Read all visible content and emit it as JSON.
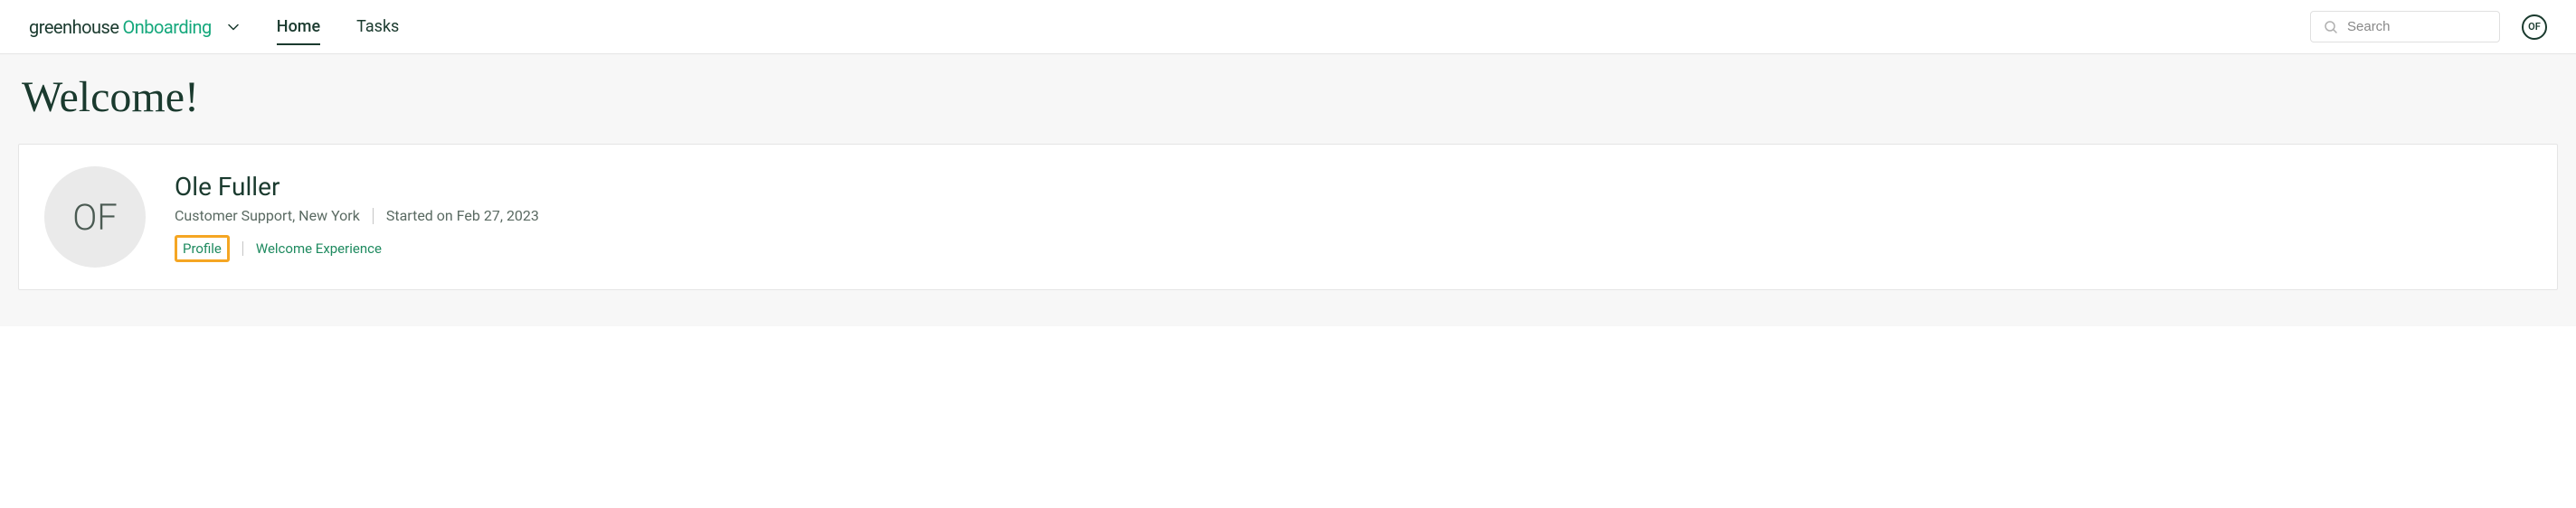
{
  "header": {
    "logo_primary": "greenhouse",
    "logo_secondary": "Onboarding",
    "nav": {
      "home": "Home",
      "tasks": "Tasks"
    },
    "search_placeholder": "Search",
    "avatar_initials": "OF"
  },
  "main": {
    "page_title": "Welcome!",
    "profile": {
      "avatar_initials": "OF",
      "name": "Ole Fuller",
      "role_location": "Customer Support, New York",
      "start_text": "Started on Feb 27, 2023",
      "links": {
        "profile": "Profile",
        "welcome_experience": "Welcome Experience"
      }
    }
  }
}
